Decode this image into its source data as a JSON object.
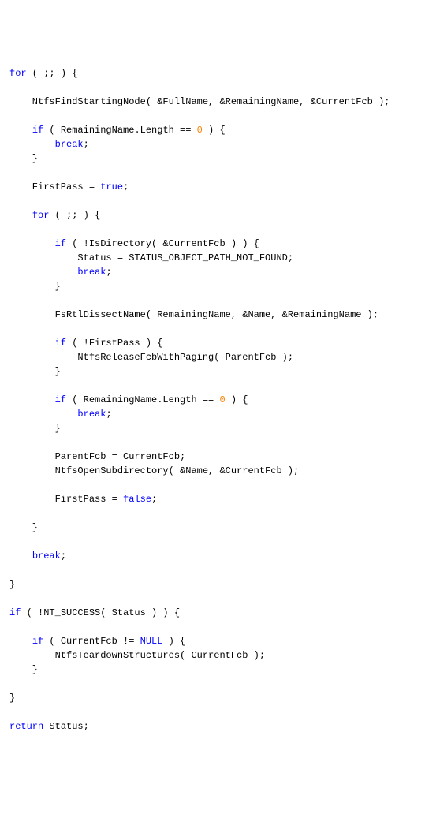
{
  "code": {
    "kw_for1": "for",
    "for1_rest": " ( ;; ) {",
    "blank": "",
    "l_find": "    NtfsFindStartingNode( &FullName, &RemainingName, &CurrentFcb );",
    "if1_pre": "    ",
    "kw_if1": "if",
    "if1_mid": " ( RemainingName.Length == ",
    "num0a": "0",
    "if1_post": " ) {",
    "brk1_pre": "        ",
    "kw_break1": "break",
    "brk1_post": ";",
    "close1": "    }",
    "fp_true_pre": "    FirstPass = ",
    "kw_true": "true",
    "fp_true_post": ";",
    "for2_pre": "    ",
    "kw_for2": "for",
    "for2_rest": " ( ;; ) {",
    "if2_pre": "        ",
    "kw_if2": "if",
    "if2_rest": " ( !IsDirectory( &CurrentFcb ) ) {",
    "status_assign": "            Status = STATUS_OBJECT_PATH_NOT_FOUND;",
    "brk2_pre": "            ",
    "kw_break2": "break",
    "brk2_post": ";",
    "close2": "        }",
    "dissect": "        FsRtlDissectName( RemainingName, &Name, &RemainingName );",
    "if3_pre": "        ",
    "kw_if3": "if",
    "if3_rest": " ( !FirstPass ) {",
    "release": "            NtfsReleaseFcbWithPaging( ParentFcb );",
    "close3": "        }",
    "if4_pre": "        ",
    "kw_if4": "if",
    "if4_mid": " ( RemainingName.Length == ",
    "num0b": "0",
    "if4_post": " ) {",
    "brk3_pre": "            ",
    "kw_break3": "break",
    "brk3_post": ";",
    "close4": "        }",
    "parent_assign": "        ParentFcb = CurrentFcb;",
    "opensub": "        NtfsOpenSubdirectory( &Name, &CurrentFcb );",
    "fp_false_pre": "        FirstPass = ",
    "kw_false": "false",
    "fp_false_post": ";",
    "close_for2": "    }",
    "brk4_pre": "    ",
    "kw_break4": "break",
    "brk4_post": ";",
    "close_for1": "}",
    "kw_if5": "if",
    "if5_rest": " ( !NT_SUCCESS( Status ) ) {",
    "if6_pre": "    ",
    "kw_if6": "if",
    "if6_mid": " ( CurrentFcb != ",
    "kw_null": "NULL",
    "if6_post": " ) {",
    "teardown": "        NtfsTeardownStructures( CurrentFcb );",
    "close6": "    }",
    "close5": "}",
    "kw_return": "return",
    "return_post": " Status;"
  }
}
